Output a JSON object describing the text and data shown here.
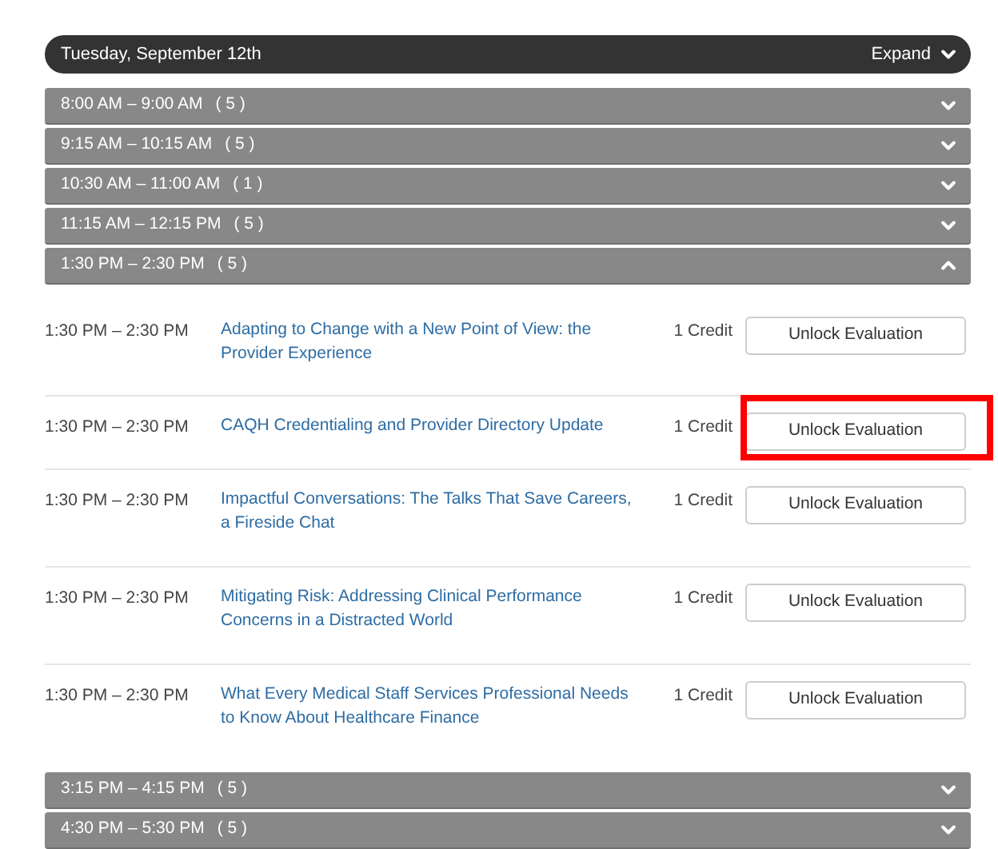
{
  "day": {
    "title": "Tuesday, September 12th",
    "expand_label": "Expand"
  },
  "slots": [
    {
      "time": "8:00 AM – 9:00 AM",
      "count": "( 5 )",
      "expanded": false
    },
    {
      "time": "9:15 AM – 10:15 AM",
      "count": "( 5 )",
      "expanded": false
    },
    {
      "time": "10:30 AM – 11:00 AM",
      "count": "( 1 )",
      "expanded": false
    },
    {
      "time": "11:15 AM – 12:15 PM",
      "count": "( 5 )",
      "expanded": false
    },
    {
      "time": "1:30 PM – 2:30 PM",
      "count": "( 5 )",
      "expanded": true,
      "sessions": [
        {
          "time": "1:30 PM – 2:30 PM",
          "title": "Adapting to Change with a New Point of View: the Provider Experience",
          "credit": "1 Credit",
          "button": "Unlock Evaluation",
          "highlighted": false
        },
        {
          "time": "1:30 PM – 2:30 PM",
          "title": "CAQH Credentialing and Provider Directory Update",
          "credit": "1 Credit",
          "button": "Unlock Evaluation",
          "highlighted": true
        },
        {
          "time": "1:30 PM – 2:30 PM",
          "title": "Impactful Conversations: The Talks That Save Careers, a Fireside Chat",
          "credit": "1 Credit",
          "button": "Unlock Evaluation",
          "highlighted": false
        },
        {
          "time": "1:30 PM – 2:30 PM",
          "title": "Mitigating Risk: Addressing Clinical Performance Concerns in a Distracted World",
          "credit": "1 Credit",
          "button": "Unlock Evaluation",
          "highlighted": false
        },
        {
          "time": "1:30 PM – 2:30 PM",
          "title": "What Every Medical Staff Services Professional Needs to Know About Healthcare Finance",
          "credit": "1 Credit",
          "button": "Unlock Evaluation",
          "highlighted": false
        }
      ]
    },
    {
      "time": "3:15 PM – 4:15 PM",
      "count": "( 5 )",
      "expanded": false
    },
    {
      "time": "4:30 PM – 5:30 PM",
      "count": "( 5 )",
      "expanded": false
    }
  ]
}
